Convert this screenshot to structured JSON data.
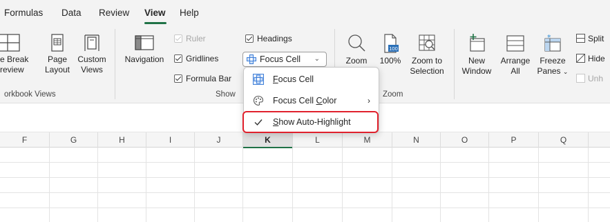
{
  "tabs": [
    {
      "label": "Formulas",
      "active": false
    },
    {
      "label": "Data",
      "active": false
    },
    {
      "label": "Review",
      "active": false
    },
    {
      "label": "View",
      "active": true
    },
    {
      "label": "Help",
      "active": false
    }
  ],
  "ribbon": {
    "workbook_views": {
      "page_break_line1": "e Break",
      "page_break_line2": "review",
      "page_layout_line1": "Page",
      "page_layout_line2": "Layout",
      "custom_views_line1": "Custom",
      "custom_views_line2": "Views",
      "label": "orkbook Views"
    },
    "navigation_label": "Navigation",
    "show": {
      "ruler": "Ruler",
      "gridlines": "Gridlines",
      "formula_bar": "Formula Bar",
      "headings": "Headings",
      "focus_cell": "Focus Cell",
      "label": "Show"
    },
    "zoom": {
      "zoom": "Zoom",
      "hundred_icon_text": "100",
      "hundred": "100%",
      "zoom_to_line1": "Zoom to",
      "zoom_to_line2": "Selection",
      "label": "Zoom"
    },
    "window": {
      "new_line1": "New",
      "new_line2": "Window",
      "arrange_line1": "Arrange",
      "arrange_line2": "All",
      "freeze_line1": "Freeze",
      "freeze_line2": "Panes",
      "split": "Split",
      "hide": "Hide",
      "unhide": "Unh"
    }
  },
  "dropdown": {
    "item1_pre": "",
    "item1_u": "F",
    "item1_post": "ocus Cell",
    "item2_pre": "Focus Cell ",
    "item2_u": "C",
    "item2_post": "olor",
    "item3_pre": "",
    "item3_u": "S",
    "item3_post": "how Auto-Highlight"
  },
  "columns": [
    "F",
    "G",
    "H",
    "I",
    "J",
    "K",
    "L",
    "M",
    "N",
    "O",
    "P",
    "Q"
  ],
  "colors": {
    "accent_green": "#1f7246",
    "highlight_red": "#e0202c",
    "focus_blue": "#3b7dd8"
  }
}
